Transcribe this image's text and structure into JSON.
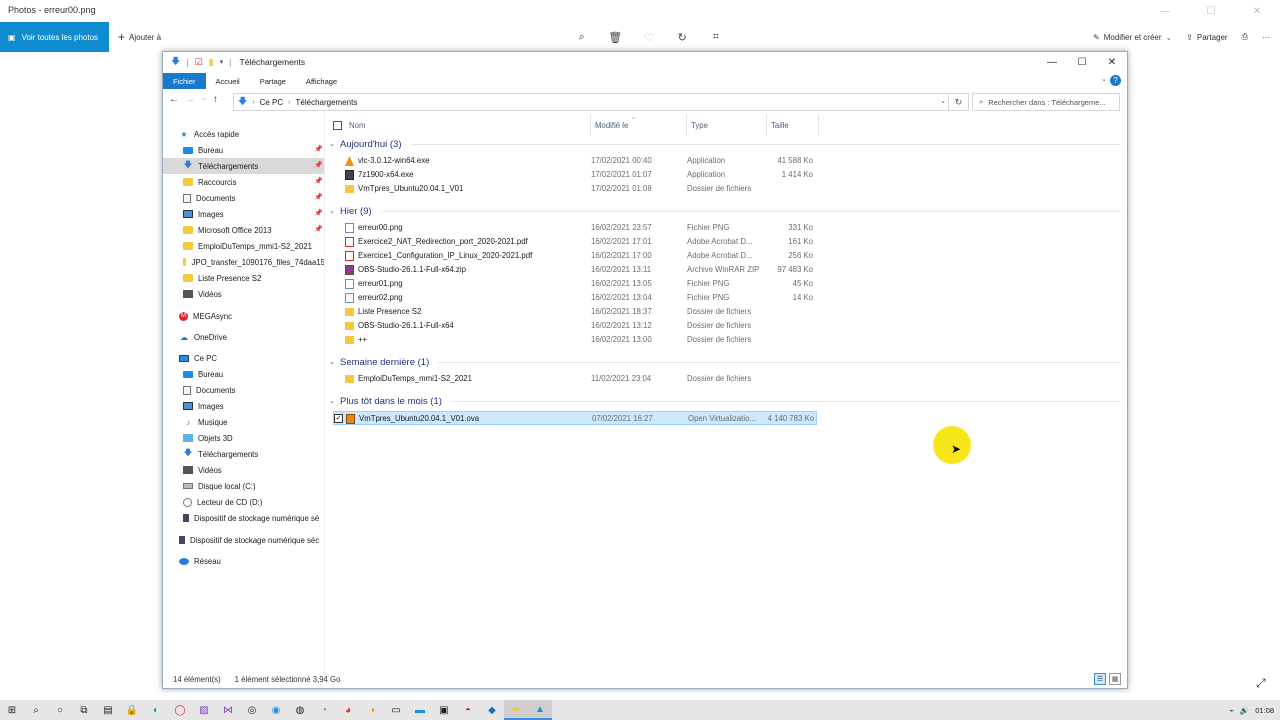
{
  "photos": {
    "title": "Photos - erreur00.png",
    "see_all": "Voir toutes les photos",
    "add_to": "Ajouter à",
    "edit_create": "Modifier et créer",
    "share": "Partager",
    "more": "···"
  },
  "explorer": {
    "title": "Téléchargements",
    "ribbon_tabs": [
      "Fichier",
      "Accueil",
      "Partage",
      "Affichage"
    ],
    "breadcrumb": [
      "Ce PC",
      "Téléchargements"
    ],
    "search_placeholder": "Rechercher dans : Téléchargeme...",
    "columns": {
      "name": "Nom",
      "modified": "Modifié le",
      "type": "Type",
      "size": "Taille"
    },
    "nav": {
      "quick_access": "Accès rapide",
      "quick_items": [
        "Bureau",
        "Téléchargements",
        "Raccourcis",
        "Documents",
        "Images",
        "Microsoft Office 2013",
        "EmploiDuTemps_mmi1-S2_2021",
        "JPO_transfer_1090176_files_74daa15",
        "Liste Presence S2",
        "Vidéos"
      ],
      "mega": "MEGAsync",
      "onedrive": "OneDrive",
      "this_pc": "Ce PC",
      "pc_items": [
        "Bureau",
        "Documents",
        "Images",
        "Musique",
        "Objets 3D",
        "Téléchargements",
        "Vidéos",
        "Disque local (C:)",
        "Lecteur de CD (D:)",
        "Dispositif de stockage numérique sé"
      ],
      "usb": "Dispositif de stockage numérique séc",
      "network": "Réseau"
    },
    "groups": [
      {
        "label": "Aujourd'hui (3)",
        "files": [
          {
            "name": "vlc-3.0.12-win64.exe",
            "date": "17/02/2021 00:40",
            "type": "Application",
            "size": "41 588 Ko",
            "icon": "app"
          },
          {
            "name": "7z1900-x64.exe",
            "date": "17/02/2021 01:07",
            "type": "Application",
            "size": "1 414 Ko",
            "icon": "exe"
          },
          {
            "name": "VmTpres_Ubuntu20.04.1_V01",
            "date": "17/02/2021 01:08",
            "type": "Dossier de fichiers",
            "size": "",
            "icon": "folder"
          }
        ]
      },
      {
        "label": "Hier (9)",
        "files": [
          {
            "name": "erreur00.png",
            "date": "16/02/2021 23:57",
            "type": "Fichier PNG",
            "size": "331 Ko",
            "icon": "png"
          },
          {
            "name": "Exercice2_NAT_Redirection_port_2020-2021.pdf",
            "date": "16/02/2021 17:01",
            "type": "Adobe Acrobat D...",
            "size": "161 Ko",
            "icon": "pdf"
          },
          {
            "name": "Exercice1_Configuration_IP_Linux_2020-2021.pdf",
            "date": "16/02/2021 17:00",
            "type": "Adobe Acrobat D...",
            "size": "256 Ko",
            "icon": "pdf"
          },
          {
            "name": "OBS-Studio-26.1.1-Full-x64.zip",
            "date": "16/02/2021 13:11",
            "type": "Archive WinRAR ZIP",
            "size": "97 483 Ko",
            "icon": "zip"
          },
          {
            "name": "erreur01.png",
            "date": "16/02/2021 13:05",
            "type": "Fichier PNG",
            "size": "45 Ko",
            "icon": "png"
          },
          {
            "name": "erreur02.png",
            "date": "16/02/2021 13:04",
            "type": "Fichier PNG",
            "size": "14 Ko",
            "icon": "png"
          },
          {
            "name": "Liste Presence S2",
            "date": "16/02/2021 18:37",
            "type": "Dossier de fichiers",
            "size": "",
            "icon": "folder"
          },
          {
            "name": "OBS-Studio-26.1.1-Full-x64",
            "date": "16/02/2021 13:12",
            "type": "Dossier de fichiers",
            "size": "",
            "icon": "folder"
          },
          {
            "name": "++",
            "date": "16/02/2021 13:00",
            "type": "Dossier de fichiers",
            "size": "",
            "icon": "folder"
          }
        ]
      },
      {
        "label": "Semaine dernière (1)",
        "files": [
          {
            "name": "EmploiDuTemps_mmi1-S2_2021",
            "date": "11/02/2021 23:04",
            "type": "Dossier de fichiers",
            "size": "",
            "icon": "folder"
          }
        ]
      },
      {
        "label": "Plus tôt dans le mois (1)",
        "files": [
          {
            "name": "VmTpres_Ubuntu20.04.1_V01.ova",
            "date": "07/02/2021 16:27",
            "type": "Open Virtualizatio...",
            "size": "4 140 783 Ko",
            "icon": "ova",
            "selected": true
          }
        ]
      }
    ],
    "status": {
      "count": "14 élément(s)",
      "selected": "1 élément sélectionné  3,94 Go"
    }
  },
  "taskbar": {
    "time": "01:08"
  }
}
